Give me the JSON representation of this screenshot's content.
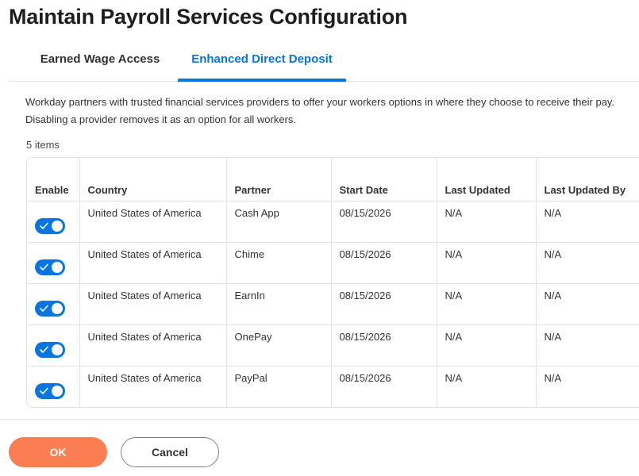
{
  "page": {
    "title": "Maintain Payroll Services Configuration"
  },
  "tabs": [
    {
      "label": "Earned Wage Access",
      "active": false
    },
    {
      "label": "Enhanced Direct Deposit",
      "active": true
    }
  ],
  "description": {
    "line1": "Workday partners with trusted financial services providers to offer your workers options in where they choose to receive their pay.",
    "line2": "Disabling a provider removes it as an option for all workers."
  },
  "items_count": "5 items",
  "table": {
    "columns": [
      "Enable",
      "Country",
      "Partner",
      "Start Date",
      "Last Updated",
      "Last Updated By"
    ],
    "rows": [
      {
        "enabled": true,
        "country": "United States of America",
        "partner": "Cash App",
        "start_date": "08/15/2026",
        "last_updated": "N/A",
        "last_updated_by": "N/A"
      },
      {
        "enabled": true,
        "country": "United States of America",
        "partner": "Chime",
        "start_date": "08/15/2026",
        "last_updated": "N/A",
        "last_updated_by": "N/A"
      },
      {
        "enabled": true,
        "country": "United States of America",
        "partner": "EarnIn",
        "start_date": "08/15/2026",
        "last_updated": "N/A",
        "last_updated_by": "N/A"
      },
      {
        "enabled": true,
        "country": "United States of America",
        "partner": "OnePay",
        "start_date": "08/15/2026",
        "last_updated": "N/A",
        "last_updated_by": "N/A"
      },
      {
        "enabled": true,
        "country": "United States of America",
        "partner": "PayPal",
        "start_date": "08/15/2026",
        "last_updated": "N/A",
        "last_updated_by": "N/A"
      }
    ]
  },
  "footer": {
    "ok_label": "OK",
    "cancel_label": "Cancel"
  },
  "colors": {
    "accent": "#0875e1",
    "primary_button": "#fb7e52"
  },
  "icons": {
    "toggle_on": "check-icon"
  }
}
